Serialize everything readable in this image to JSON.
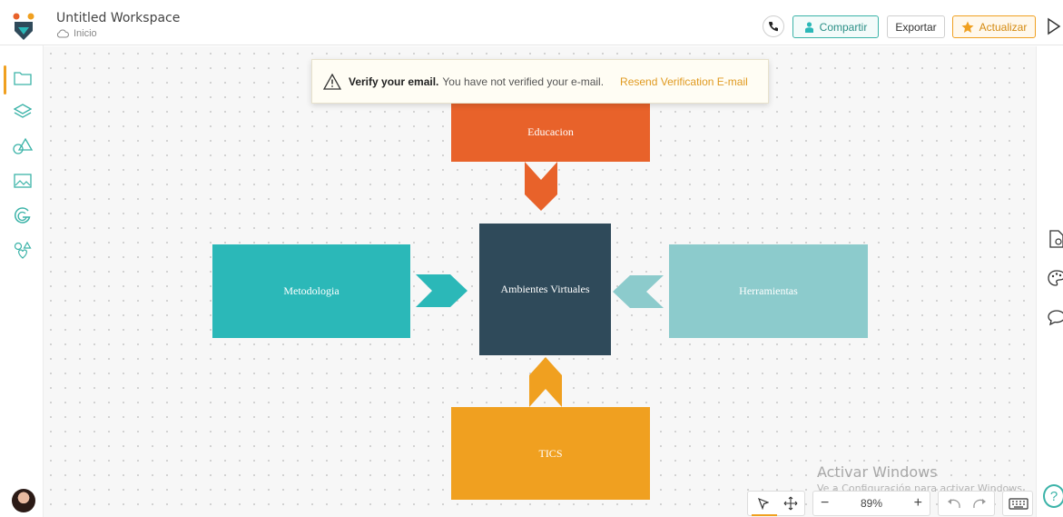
{
  "header": {
    "workspace_title": "Untitled Workspace",
    "breadcrumb": "Inicio",
    "share_label": "Compartir",
    "export_label": "Exportar",
    "upgrade_label": "Actualizar"
  },
  "banner": {
    "title": "Verify your email.",
    "message": "You have not verified your e-mail.",
    "link": "Resend Verification E-mail"
  },
  "diagram": {
    "center": "Ambientes Virtuales",
    "top": "Educacion",
    "left": "Metodologia",
    "right": "Herramientas",
    "bottom": "TICS",
    "colors": {
      "top": "#e8622a",
      "center": "#2f4a5a",
      "left": "#2bb8b8",
      "right": "#8ccbcc",
      "bottom": "#f0a020"
    }
  },
  "sidebar": {
    "items": [
      "folder-icon",
      "layers-icon",
      "shapes-icon",
      "image-icon",
      "grammarly-icon",
      "ideas-icon"
    ]
  },
  "zoom": {
    "value": "89%",
    "minus": "−",
    "plus": "+"
  },
  "watermark": {
    "line1": "Activar Windows",
    "line2": "Ve a Configuración para activar Windows."
  },
  "help": "?"
}
